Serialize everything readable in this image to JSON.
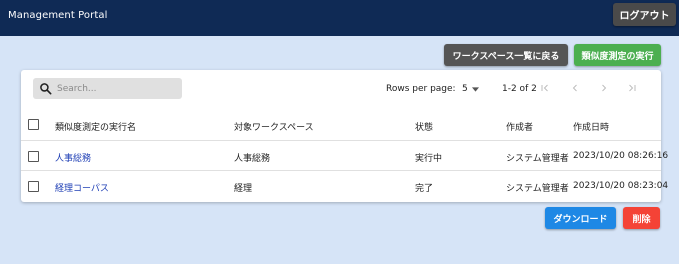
{
  "header": {
    "brand": "Management Portal",
    "logout_label": "ログアウト"
  },
  "actions": {
    "back_label": "ワークスペース一覧に戻る",
    "run_label": "類似度測定の実行",
    "download_label": "ダウンロード",
    "delete_label": "削除"
  },
  "toolbar": {
    "search_placeholder": "Search...",
    "rows_per_page_label": "Rows per page:",
    "rows_per_page_value": "5",
    "page_range": "1-2 of 2"
  },
  "table": {
    "columns": [
      "類似度測定の実行名",
      "対象ワークスペース",
      "状態",
      "作成者",
      "作成日時"
    ],
    "rows": [
      {
        "name": "人事総務",
        "workspace": "人事総務",
        "status": "実行中",
        "creator": "システム管理者",
        "created_at": "2023/10/20 08:26:16"
      },
      {
        "name": "経理コーパス",
        "workspace": "経理",
        "status": "完了",
        "creator": "システム管理者",
        "created_at": "2023/10/20 08:23:04"
      }
    ]
  },
  "colors": {
    "header_bg": "#0f2a55",
    "page_bg": "#d6e4f7",
    "run_button": "#4caf50",
    "download_button": "#1e88e5",
    "delete_button": "#f44336",
    "link": "#1f3fb5"
  },
  "icons": [
    "search-icon",
    "caret-down-icon",
    "first-page-icon",
    "prev-page-icon",
    "next-page-icon",
    "last-page-icon"
  ]
}
